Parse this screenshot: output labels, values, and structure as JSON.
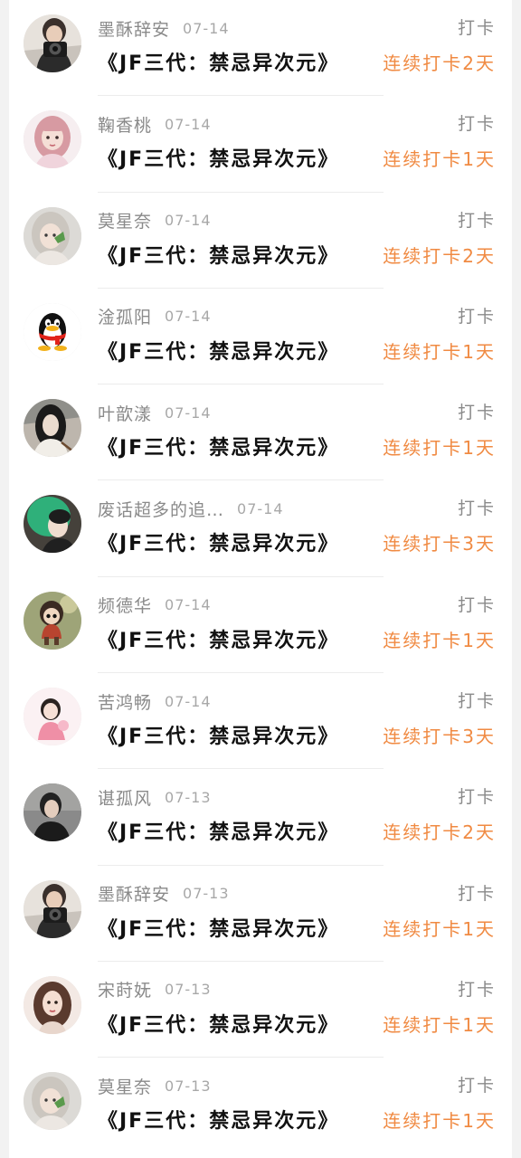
{
  "list": {
    "items": [
      {
        "name": "墨酥辞安",
        "date": "07-14",
        "book": "《JF三代：禁忌异次元》",
        "action": "打卡",
        "streak": "连续打卡2天",
        "avatar_icon": "camera-user-icon"
      },
      {
        "name": "鞠香桃",
        "date": "07-14",
        "book": "《JF三代：禁忌异次元》",
        "action": "打卡",
        "streak": "连续打卡1天",
        "avatar_icon": "pink-hair-user-icon"
      },
      {
        "name": "莫星奈",
        "date": "07-14",
        "book": "《JF三代：禁忌异次元》",
        "action": "打卡",
        "streak": "连续打卡2天",
        "avatar_icon": "silver-hair-user-icon"
      },
      {
        "name": "淦孤阳",
        "date": "07-14",
        "book": "《JF三代：禁忌异次元》",
        "action": "打卡",
        "streak": "连续打卡1天",
        "avatar_icon": "penguin-icon"
      },
      {
        "name": "叶歆漾",
        "date": "07-14",
        "book": "《JF三代：禁忌异次元》",
        "action": "打卡",
        "streak": "连续打卡1天",
        "avatar_icon": "dark-hair-user-icon"
      },
      {
        "name": "废话超多的追…",
        "date": "07-14",
        "book": "《JF三代：禁忌异次元》",
        "action": "打卡",
        "streak": "连续打卡3天",
        "avatar_icon": "green-costume-user-icon"
      },
      {
        "name": "频德华",
        "date": "07-14",
        "book": "《JF三代：禁忌异次元》",
        "action": "打卡",
        "streak": "连续打卡1天",
        "avatar_icon": "figurine-icon"
      },
      {
        "name": "苦鸿畅",
        "date": "07-14",
        "book": "《JF三代：禁忌异次元》",
        "action": "打卡",
        "streak": "连续打卡3天",
        "avatar_icon": "pink-outfit-user-icon"
      },
      {
        "name": "谌孤风",
        "date": "07-13",
        "book": "《JF三代：禁忌异次元》",
        "action": "打卡",
        "streak": "连续打卡2天",
        "avatar_icon": "dark-outfit-user-icon"
      },
      {
        "name": "墨酥辞安",
        "date": "07-13",
        "book": "《JF三代：禁忌异次元》",
        "action": "打卡",
        "streak": "连续打卡1天",
        "avatar_icon": "camera-user-icon"
      },
      {
        "name": "宋莳妩",
        "date": "07-13",
        "book": "《JF三代：禁忌异次元》",
        "action": "打卡",
        "streak": "连续打卡1天",
        "avatar_icon": "portrait-user-icon"
      },
      {
        "name": "莫星奈",
        "date": "07-13",
        "book": "《JF三代：禁忌异次元》",
        "action": "打卡",
        "streak": "连续打卡1天",
        "avatar_icon": "silver-hair-user-icon"
      }
    ]
  },
  "colors": {
    "accent": "#f08a42",
    "name": "#8a8a8a",
    "date": "#a8a8a8",
    "title": "#111111",
    "background": "#ffffff",
    "page_edge": "#f2f2f2"
  }
}
